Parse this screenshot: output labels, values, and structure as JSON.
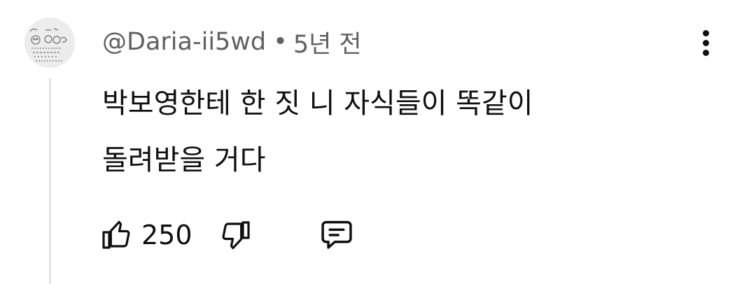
{
  "comment": {
    "author": "@Daria-ii5wd",
    "separator": "•",
    "timestamp": "5년 전",
    "text_line1": "박보영한테 한 짓 니 자식들이 똑같이",
    "text_line2": "돌려받을 거다",
    "like_count": "250"
  },
  "icons": {
    "avatar": "avatar-doodle",
    "more": "more-vertical-icon",
    "like": "thumbs-up-icon",
    "dislike": "thumbs-down-icon",
    "reply": "reply-comment-icon"
  }
}
